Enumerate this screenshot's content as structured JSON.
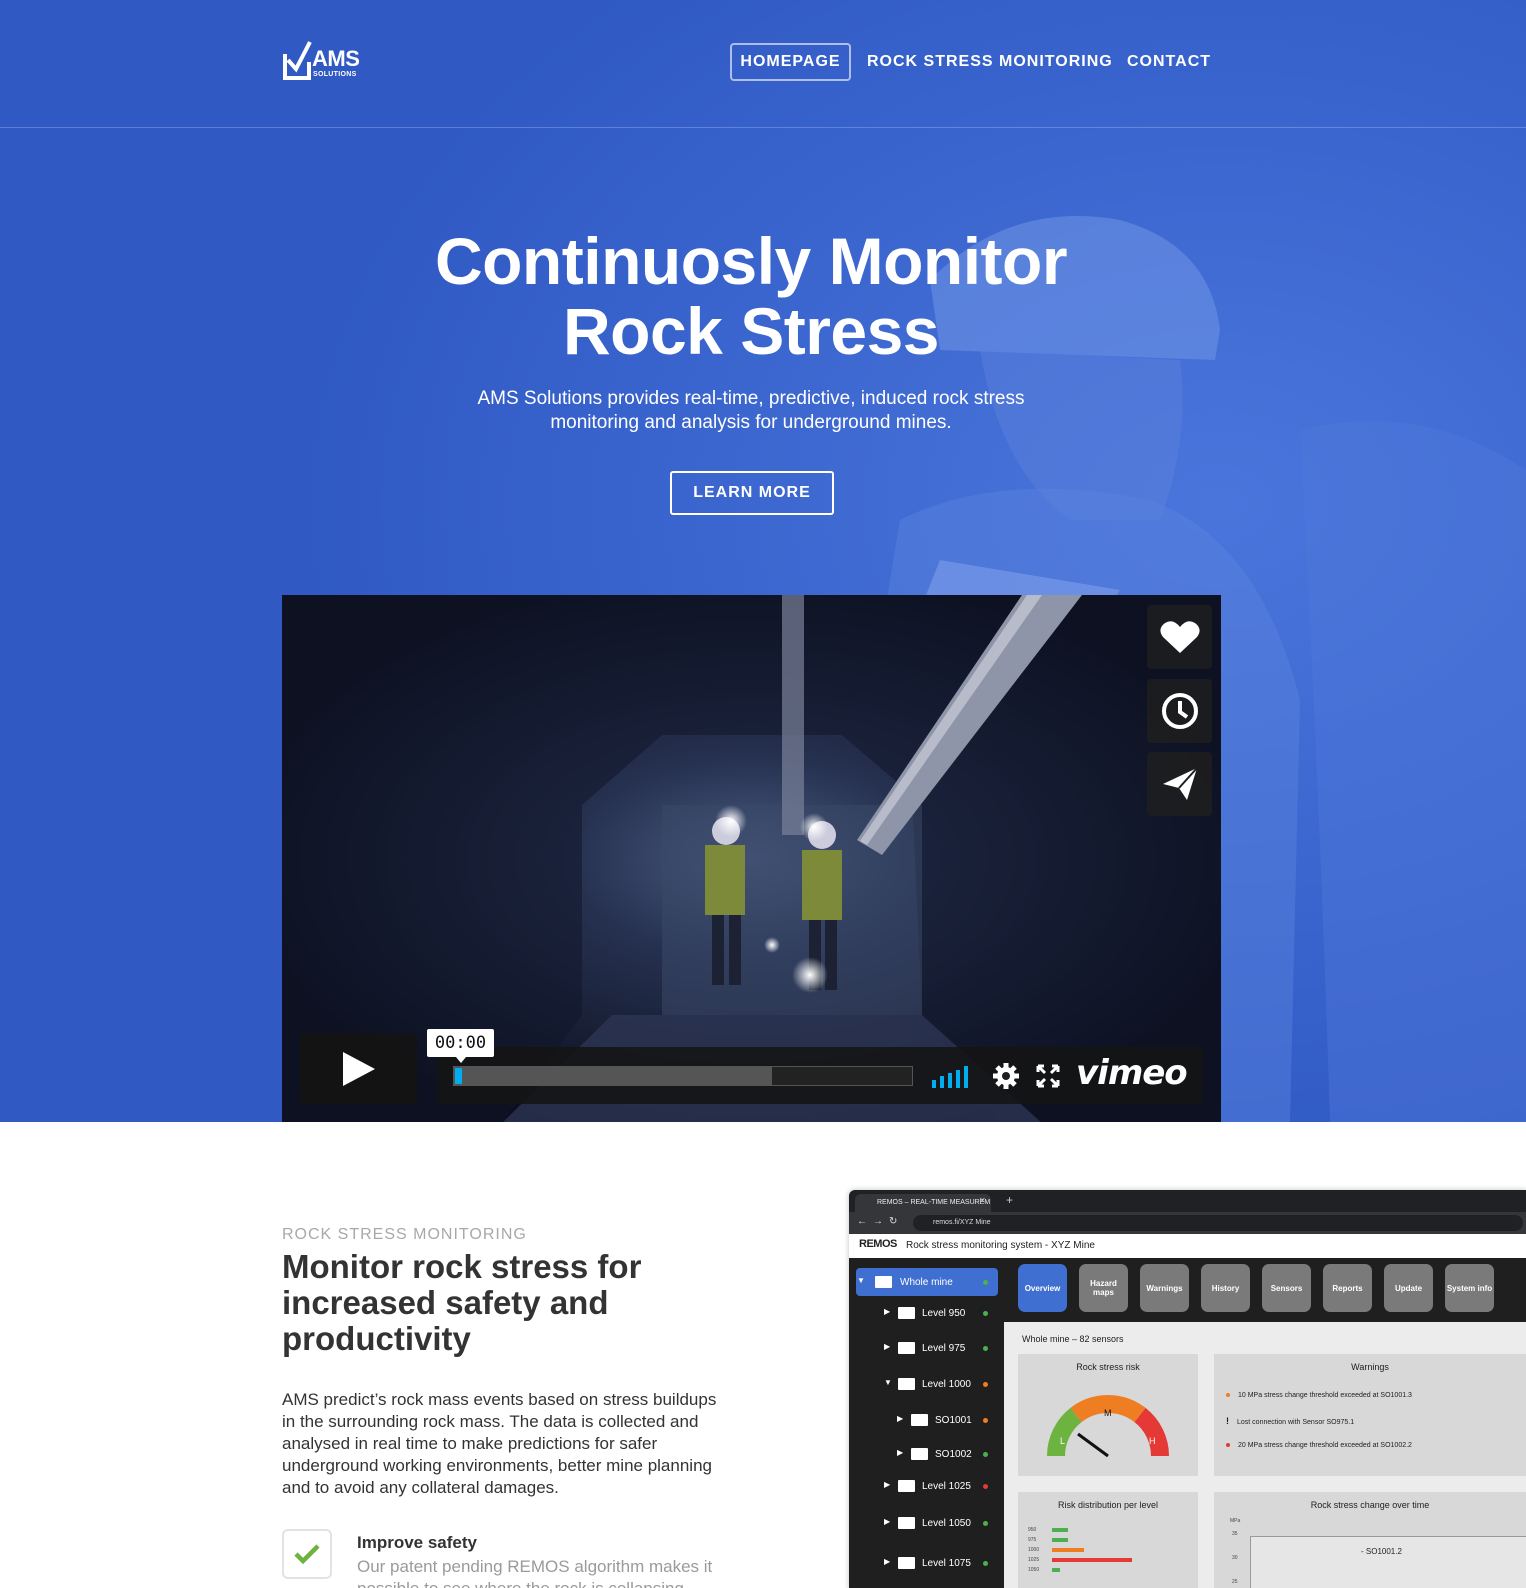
{
  "nav": {
    "logo_text": "AMS",
    "logo_sub": "SOLUTIONS",
    "items": [
      {
        "label": "HOMEPAGE",
        "active": true
      },
      {
        "label": "ROCK STRESS MONITORING",
        "active": false
      },
      {
        "label": "CONTACT",
        "active": false
      }
    ]
  },
  "hero": {
    "title_line1": "Continuosly Monitor",
    "title_line2": "Rock Stress",
    "subtitle_line1": "AMS Solutions provides real-time, predictive, induced rock stress",
    "subtitle_line2": "monitoring and analysis for underground mines.",
    "cta_label": "LEARN MORE",
    "background_color": "#3059c4"
  },
  "video": {
    "time": "00:00",
    "progress_played": 0.015,
    "progress_buffered": 0.69,
    "side_buttons": [
      "heart-icon",
      "clock-icon",
      "send-icon"
    ],
    "brand": "vimeo"
  },
  "section": {
    "eyebrow": "ROCK STRESS MONITORING",
    "title": "Monitor rock stress for increased safety and productivity",
    "body": "AMS predict’s rock mass events based on stress buildups in the surrounding rock mass. The data is collected and analysed in real time to make predictions for safer underground working environments, better mine planning and to avoid any collateral damages.",
    "feature_title": "Improve safety",
    "feature_desc": "Our patent pending REMOS algorithm makes it possible to see where the rock is collapsing"
  },
  "app": {
    "tab_title": "REMOS – REAL-TIME MEASUREM",
    "url": "remos.fi/XYZ Mine",
    "brand": "REMOS",
    "header_title": "Rock stress monitoring system - XYZ Mine",
    "sidebar": [
      {
        "label": "Whole mine",
        "indent": 0,
        "open": true,
        "dot": "#4caf50",
        "active": true
      },
      {
        "label": "Level 950",
        "indent": 1,
        "open": false,
        "dot": "#4caf50"
      },
      {
        "label": "Level 975",
        "indent": 1,
        "open": false,
        "dot": "#4caf50"
      },
      {
        "label": "Level 1000",
        "indent": 1,
        "open": true,
        "dot": "#ef7d22"
      },
      {
        "label": "SO1001",
        "indent": 2,
        "open": false,
        "dot": "#ef7d22"
      },
      {
        "label": "SO1002",
        "indent": 2,
        "open": false,
        "dot": "#4caf50"
      },
      {
        "label": "Level 1025",
        "indent": 1,
        "open": false,
        "dot": "#e53935"
      },
      {
        "label": "Level 1050",
        "indent": 1,
        "open": false,
        "dot": "#4caf50"
      },
      {
        "label": "Level 1075",
        "indent": 1,
        "open": false,
        "dot": "#4caf50"
      }
    ],
    "tabs": [
      "Overview",
      "Hazard maps",
      "Warnings",
      "History",
      "Sensors",
      "Reports",
      "Update",
      "System info"
    ],
    "subhead": "Whole mine – 82 sensors",
    "risk_title": "Rock stress risk",
    "gauge_labels": [
      "L",
      "M",
      "H"
    ],
    "warnings_title": "Warnings",
    "warnings": [
      {
        "text": "10 MPa stress change threshold exceeded at SO1001.3",
        "marker": "dot",
        "color": "#ef7d22"
      },
      {
        "text": "Lost connection with Sensor SO975.1",
        "marker": "!",
        "color": "#222222"
      },
      {
        "text": "20 MPa stress change threshold exceeded at SO1002.2",
        "marker": "dot",
        "color": "#e53935"
      }
    ],
    "dist_title": "Risk distribution per level",
    "dist_levels": [
      "950",
      "975",
      "1000",
      "1025",
      "1050"
    ],
    "dist_values": [
      2,
      2,
      4,
      10,
      1
    ],
    "dist_colors": [
      "#4caf50",
      "#4caf50",
      "#ef7d22",
      "#e53935",
      "#4caf50"
    ],
    "change_title": "Rock stress change over time",
    "change_unit": "MPa",
    "change_ticks": [
      "35",
      "30",
      "25"
    ],
    "change_series": "SO1001.2"
  }
}
